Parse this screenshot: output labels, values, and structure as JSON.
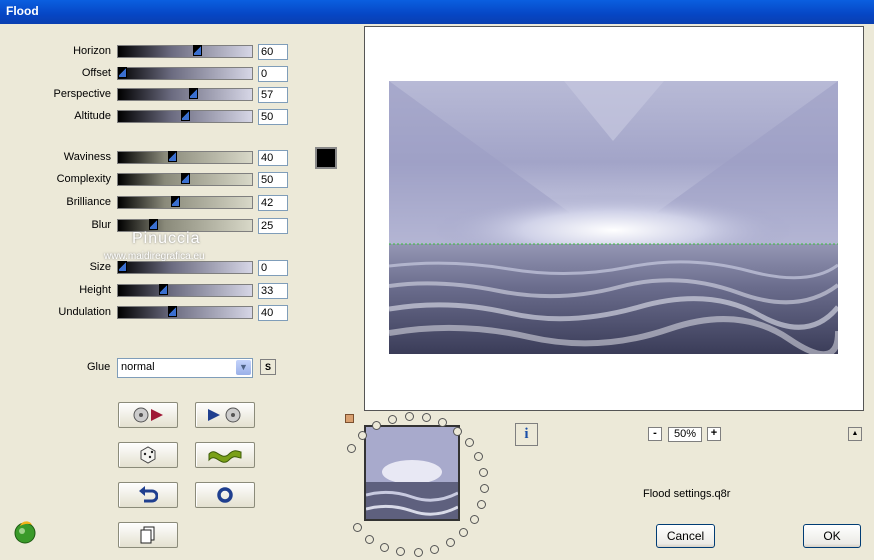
{
  "window": {
    "title": "Flood"
  },
  "sliders": [
    {
      "label": "Horizon",
      "value": "60",
      "level": 0.6,
      "style": "blue"
    },
    {
      "label": "Offset",
      "value": "0",
      "level": 0.0,
      "style": "blue"
    },
    {
      "label": "Perspective",
      "value": "57",
      "level": 0.57,
      "style": "blue"
    },
    {
      "label": "Altitude",
      "value": "50",
      "level": 0.5,
      "style": "blue"
    },
    {
      "label": "Waviness",
      "value": "40",
      "level": 0.4,
      "style": "gray"
    },
    {
      "label": "Complexity",
      "value": "50",
      "level": 0.5,
      "style": "gray"
    },
    {
      "label": "Brilliance",
      "value": "42",
      "level": 0.42,
      "style": "gray"
    },
    {
      "label": "Blur",
      "value": "25",
      "level": 0.25,
      "style": "gray"
    },
    {
      "label": "Size",
      "value": "0",
      "level": 0.0,
      "style": "blue"
    },
    {
      "label": "Height",
      "value": "33",
      "level": 0.33,
      "style": "blue"
    },
    {
      "label": "Undulation",
      "value": "40",
      "level": 0.4,
      "style": "blue"
    }
  ],
  "color_swatch": {
    "color": "#000000"
  },
  "glue": {
    "label": "Glue",
    "value": "normal",
    "s_button": "S"
  },
  "action_buttons": [
    {
      "icon": "load-preset-icon"
    },
    {
      "icon": "save-preset-icon"
    },
    {
      "icon": "randomize-dice-icon"
    },
    {
      "icon": "wave-icon"
    },
    {
      "icon": "undo-icon"
    },
    {
      "icon": "reset-icon"
    },
    {
      "icon": "copy-icon"
    }
  ],
  "watermark": {
    "name": "Pinuccia",
    "site": "www.maidiregrafica.eu"
  },
  "info_button": {
    "label": "i"
  },
  "zoom": {
    "minus": "-",
    "value": "50%",
    "plus": "+"
  },
  "collapse_button": {
    "label": "▲"
  },
  "settings_file": "Flood settings.q8r",
  "dialog_buttons": {
    "cancel": "Cancel",
    "ok": "OK"
  },
  "colors": {
    "accent": "#0a5fe0",
    "preview_tint": "#9a9cc4"
  }
}
